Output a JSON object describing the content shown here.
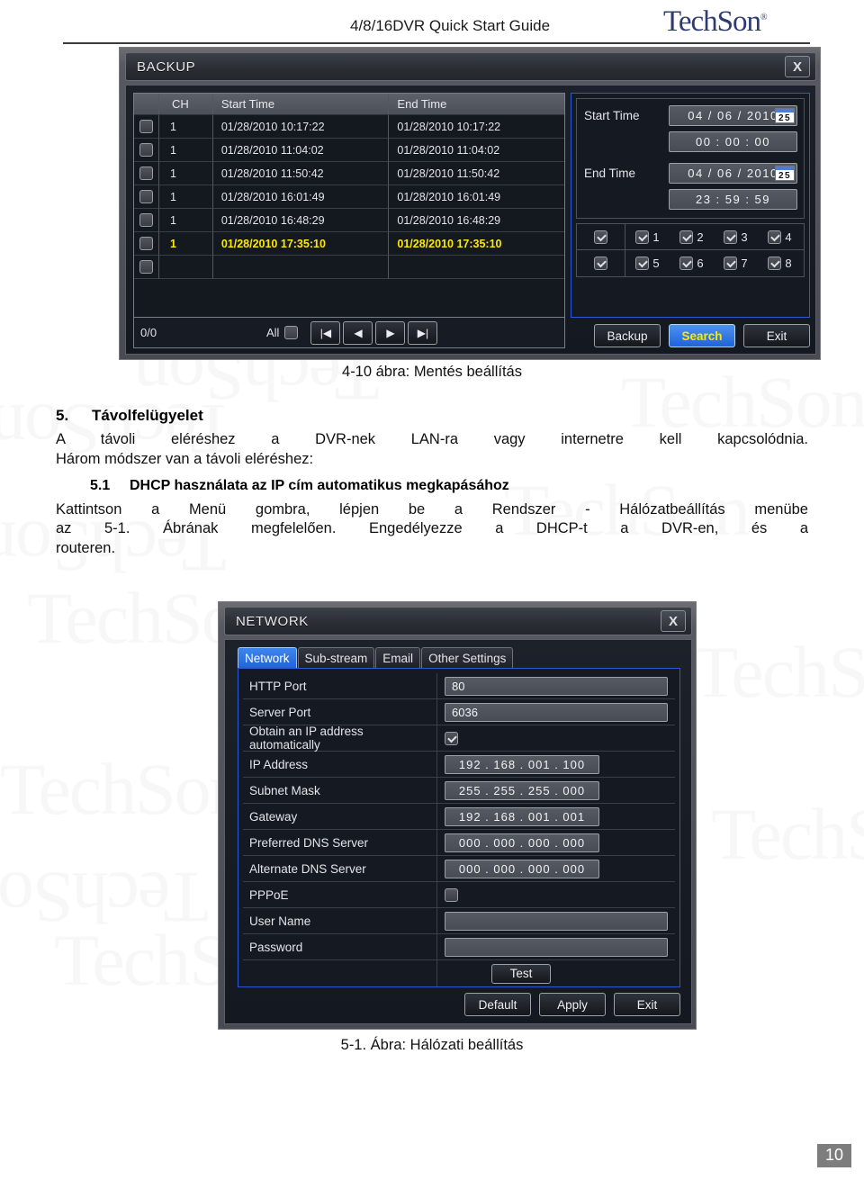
{
  "page": {
    "doc_title": "4/8/16DVR Quick Start Guide",
    "brand": "TechSon",
    "brand_reg": "®",
    "page_number": "10"
  },
  "backup_dialog": {
    "title": "BACKUP",
    "close_label": "X",
    "table": {
      "headers": {
        "check": "",
        "ch": "CH",
        "start": "Start Time",
        "end": "End Time"
      },
      "rows": [
        {
          "ch": "1",
          "start": "01/28/2010 10:17:22",
          "end": "01/28/2010 10:17:22",
          "selected": false
        },
        {
          "ch": "1",
          "start": "01/28/2010 11:04:02",
          "end": "01/28/2010 11:04:02",
          "selected": false
        },
        {
          "ch": "1",
          "start": "01/28/2010 11:50:42",
          "end": "01/28/2010 11:50:42",
          "selected": false
        },
        {
          "ch": "1",
          "start": "01/28/2010 16:01:49",
          "end": "01/28/2010 16:01:49",
          "selected": false
        },
        {
          "ch": "1",
          "start": "01/28/2010 16:48:29",
          "end": "01/28/2010 16:48:29",
          "selected": false
        },
        {
          "ch": "1",
          "start": "01/28/2010 17:35:10",
          "end": "01/28/2010 17:35:10",
          "selected": true
        },
        {
          "ch": "",
          "start": "",
          "end": "",
          "selected": false
        }
      ]
    },
    "pager": {
      "count": "0/0",
      "all_label": "All",
      "first_icon": "first-page-icon",
      "prev_icon": "prev-page-icon",
      "next_icon": "next-page-icon",
      "last_icon": "last-page-icon",
      "first_glyph": "|◀",
      "prev_glyph": "◀",
      "next_glyph": "▶",
      "last_glyph": "▶|"
    },
    "search_panel": {
      "start_time_label": "Start Time",
      "end_time_label": "End Time",
      "start_date": "04 / 06 / 2010",
      "start_clock": "00 : 00 : 00",
      "end_date": "04 / 06 / 2010",
      "end_clock": "23 : 59 : 59",
      "calendar_icon_day": "25",
      "channels_row1": [
        "1",
        "2",
        "3",
        "4"
      ],
      "channels_row2": [
        "5",
        "6",
        "7",
        "8"
      ]
    },
    "buttons": {
      "backup": "Backup",
      "search": "Search",
      "exit": "Exit"
    }
  },
  "figure_caption_1": "4-10 ábra: Mentés beállítás",
  "section": {
    "number": "5.",
    "heading": "Távolfelügyelet",
    "paragraph1": "A távoli eléréshez a DVR-nek LAN-ra vagy internetre kell kapcsolódnia.",
    "paragraph2": "Három módszer van a távoli eléréshez:",
    "sub_number": "5.1",
    "sub_heading": "DHCP használata az IP cím automatikus megkapásához",
    "paragraph3": "Kattintson a Menü gombra, lépjen be a Rendszer - Hálózatbeállítás menübe",
    "paragraph4": "az 5-1. Ábrának megfelelően. Engedélyezze a DHCP-t a DVR-en, és a",
    "paragraph5": "routeren."
  },
  "network_dialog": {
    "title": "NETWORK",
    "close_label": "X",
    "tabs": [
      {
        "label": "Network",
        "active": true
      },
      {
        "label": "Sub-stream",
        "active": false
      },
      {
        "label": "Email",
        "active": false
      },
      {
        "label": "Other Settings",
        "active": false
      }
    ],
    "fields": [
      {
        "label": "HTTP Port",
        "value": "80",
        "type": "text"
      },
      {
        "label": "Server Port",
        "value": "6036",
        "type": "text"
      },
      {
        "label": "Obtain an IP address automatically",
        "value": "",
        "type": "checkbox",
        "checked": true
      },
      {
        "label": "IP Address",
        "value": "192 . 168 . 001 . 100",
        "type": "ip"
      },
      {
        "label": "Subnet Mask",
        "value": "255 . 255 . 255 . 000",
        "type": "ip"
      },
      {
        "label": "Gateway",
        "value": "192 . 168 . 001 . 001",
        "type": "ip"
      },
      {
        "label": "Preferred DNS Server",
        "value": "000 . 000 . 000 . 000",
        "type": "ip"
      },
      {
        "label": "Alternate DNS Server",
        "value": "000 . 000 . 000 . 000",
        "type": "ip"
      },
      {
        "label": "PPPoE",
        "value": "",
        "type": "checkbox",
        "checked": false
      },
      {
        "label": "User Name",
        "value": "",
        "type": "text"
      },
      {
        "label": "Password",
        "value": "",
        "type": "text"
      },
      {
        "label": "",
        "value": "Test",
        "type": "button"
      }
    ],
    "buttons": {
      "default": "Default",
      "apply": "Apply",
      "exit": "Exit"
    }
  },
  "figure_caption_2": "5-1. Ábra: Hálózati beállítás",
  "colors": {
    "accent_blue": "#2a5bd7",
    "highlight_yellow": "#ffe800",
    "brand_navy": "#2e3b73",
    "panel_dark": "#141922"
  }
}
